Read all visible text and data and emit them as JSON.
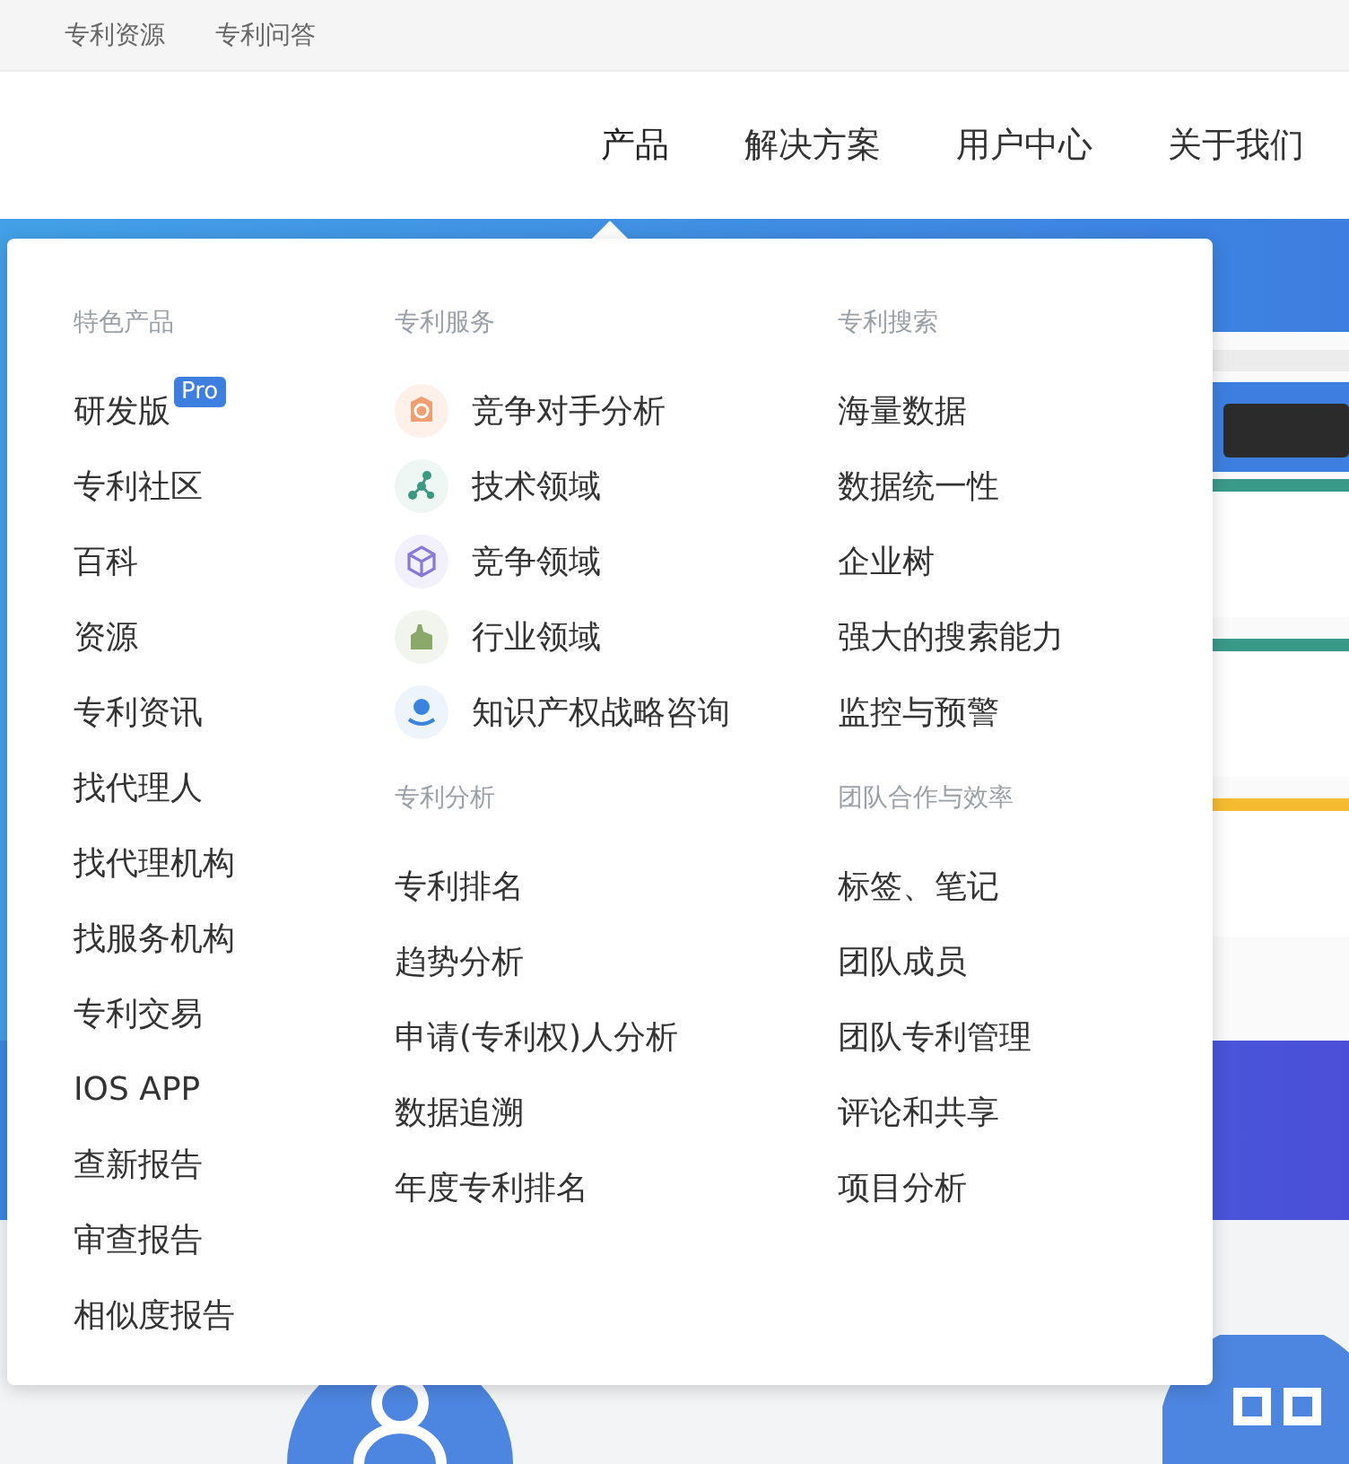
{
  "top_links": [
    "专利资源",
    "专利问答"
  ],
  "nav": [
    {
      "label": "产品",
      "expanded": true
    },
    {
      "label": "解决方案",
      "expanded": false
    },
    {
      "label": "用户中心",
      "expanded": false
    },
    {
      "label": "关于我们",
      "expanded": false
    }
  ],
  "dropdown": {
    "columns": [
      {
        "sections": [
          {
            "title": "特色产品",
            "items": [
              {
                "kind": "plain",
                "label": "研发版",
                "badge": "Pro"
              },
              {
                "kind": "plain",
                "label": "专利社区"
              },
              {
                "kind": "plain",
                "label": "百科"
              },
              {
                "kind": "plain",
                "label": "资源"
              },
              {
                "kind": "plain",
                "label": "专利资讯"
              },
              {
                "kind": "plain",
                "label": "找代理人"
              },
              {
                "kind": "plain",
                "label": "找代理机构"
              },
              {
                "kind": "plain",
                "label": "找服务机构"
              },
              {
                "kind": "plain",
                "label": "专利交易"
              },
              {
                "kind": "plain",
                "label": "IOS APP"
              },
              {
                "kind": "plain",
                "label": "查新报告"
              },
              {
                "kind": "plain",
                "label": "审查报告"
              },
              {
                "kind": "plain",
                "label": "相似度报告"
              }
            ]
          }
        ]
      },
      {
        "sections": [
          {
            "title": "专利服务",
            "items": [
              {
                "kind": "icon",
                "label": "竞争对手分析"
              },
              {
                "kind": "icon",
                "label": "技术领域"
              },
              {
                "kind": "icon",
                "label": "竞争领域"
              },
              {
                "kind": "icon",
                "label": "行业领域"
              },
              {
                "kind": "icon",
                "label": "知识产权战略咨询"
              }
            ]
          },
          {
            "title": "专利分析",
            "items": [
              {
                "kind": "plain",
                "label": "专利排名"
              },
              {
                "kind": "plain",
                "label": "趋势分析"
              },
              {
                "kind": "plain",
                "label": "申请(专利权)人分析"
              },
              {
                "kind": "plain",
                "label": "数据追溯"
              },
              {
                "kind": "plain",
                "label": "年度专利排名"
              }
            ]
          }
        ]
      },
      {
        "sections": [
          {
            "title": "专利搜索",
            "items": [
              {
                "kind": "plain",
                "label": "海量数据"
              },
              {
                "kind": "plain",
                "label": "数据统一性"
              },
              {
                "kind": "plain",
                "label": "企业树"
              },
              {
                "kind": "plain",
                "label": "强大的搜索能力"
              },
              {
                "kind": "plain",
                "label": "监控与预警"
              }
            ]
          },
          {
            "title": "团队合作与效率",
            "items": [
              {
                "kind": "plain",
                "label": "标签、笔记"
              },
              {
                "kind": "plain",
                "label": "团队成员"
              },
              {
                "kind": "plain",
                "label": "团队专利管理"
              },
              {
                "kind": "plain",
                "label": "评论和共享"
              },
              {
                "kind": "plain",
                "label": "项目分析"
              }
            ]
          }
        ]
      }
    ]
  }
}
